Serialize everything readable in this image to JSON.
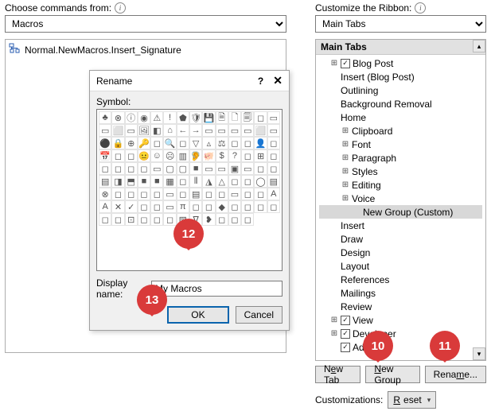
{
  "left": {
    "choose_label": "Choose commands from:",
    "choose_value": "Macros",
    "macro_item": "Normal.NewMacros.Insert_Signature"
  },
  "right": {
    "customize_label": "Customize the Ribbon:",
    "customize_value": "Main Tabs",
    "tabs_header": "Main Tabs",
    "nodes": [
      {
        "level": 1,
        "exp": "+",
        "chk": true,
        "label": "Blog Post"
      },
      {
        "level": 1,
        "exp": "",
        "chk": null,
        "label": "Insert (Blog Post)"
      },
      {
        "level": 1,
        "exp": "",
        "chk": null,
        "label": "Outlining"
      },
      {
        "level": 1,
        "exp": "",
        "chk": null,
        "label": "Background Removal"
      },
      {
        "level": 1,
        "exp": "",
        "chk": null,
        "label": "Home"
      },
      {
        "level": 2,
        "exp": "+",
        "chk": null,
        "label": "Clipboard"
      },
      {
        "level": 2,
        "exp": "+",
        "chk": null,
        "label": "Font"
      },
      {
        "level": 2,
        "exp": "+",
        "chk": null,
        "label": "Paragraph"
      },
      {
        "level": 2,
        "exp": "+",
        "chk": null,
        "label": "Styles"
      },
      {
        "level": 2,
        "exp": "+",
        "chk": null,
        "label": "Editing"
      },
      {
        "level": 2,
        "exp": "+",
        "chk": null,
        "label": "Voice"
      },
      {
        "level": 3,
        "exp": "",
        "chk": null,
        "label": "New Group (Custom)",
        "sel": true
      },
      {
        "level": 1,
        "exp": "",
        "chk": null,
        "label": "Insert"
      },
      {
        "level": 1,
        "exp": "",
        "chk": null,
        "label": "Draw"
      },
      {
        "level": 1,
        "exp": "",
        "chk": null,
        "label": "Design"
      },
      {
        "level": 1,
        "exp": "",
        "chk": null,
        "label": "Layout"
      },
      {
        "level": 1,
        "exp": "",
        "chk": null,
        "label": "References"
      },
      {
        "level": 1,
        "exp": "",
        "chk": null,
        "label": "Mailings"
      },
      {
        "level": 1,
        "exp": "",
        "chk": null,
        "label": "Review"
      },
      {
        "level": 1,
        "exp": "+",
        "chk": true,
        "label": "View"
      },
      {
        "level": 1,
        "exp": "+",
        "chk": true,
        "label": "Developer"
      },
      {
        "level": 1,
        "exp": "",
        "chk": true,
        "label": "Add-ins"
      }
    ],
    "new_tab": "New Tab",
    "new_group": "New Group",
    "rename": "Rename...",
    "customizations": "Customizations:",
    "reset": "Reset"
  },
  "dialog": {
    "title": "Rename",
    "symbol_label": "Symbol:",
    "display_label": "Display name:",
    "display_value": "My Macros",
    "ok": "OK",
    "cancel": "Cancel",
    "symbols": [
      "♣",
      "⊗",
      "ⓘ",
      "◉",
      "⚠",
      "!",
      "⬟",
      "🛡",
      "💾",
      "🗎",
      "🗋",
      "🗐",
      "◻",
      "▭",
      "▭",
      "⬜",
      "▭",
      "🖼",
      "◧",
      "⌂",
      "←",
      "→",
      "▭",
      "▭",
      "▭",
      "▭",
      "⬜",
      "▭",
      "⚫",
      "🔒",
      "⊕",
      "🔑",
      "◻",
      "🔍",
      "◻",
      "▽",
      "▵",
      "⚖",
      "◻",
      "◻",
      "👤",
      "◻",
      "📅",
      "◻",
      "◻",
      "😐",
      "☺",
      "☹",
      "▥",
      "🦻",
      "🐖",
      "$",
      "?",
      "◻",
      "⊞",
      "◻",
      "◻",
      "◻",
      "◻",
      "◻",
      "▭",
      "▢",
      "▢",
      "■",
      "▭",
      "▭",
      "▣",
      "▭",
      "◻",
      "◻",
      "▤",
      "◨",
      "⬒",
      "■",
      "■",
      "▦",
      "◻",
      "⫴",
      "◮",
      "△",
      "◻",
      "◻",
      "◯",
      "▤",
      "⊗",
      "◻",
      "◻",
      "◻",
      "◻",
      "▭",
      "◻",
      "▤",
      "◻",
      "◻",
      "▭",
      "◻",
      "◻",
      "A",
      "A",
      "✕",
      "✓",
      "◻",
      "◻",
      "▭",
      "π",
      "◻",
      "◻",
      "◆",
      "◻",
      "◻",
      "◻",
      "◻",
      "◻",
      "◻",
      "⊡",
      "◻",
      "◻",
      "◻",
      "▨",
      "ᐁ",
      "❥",
      "◻",
      "◻",
      "◻"
    ]
  },
  "callouts": {
    "c10": "10",
    "c11": "11",
    "c12": "12",
    "c13": "13"
  }
}
